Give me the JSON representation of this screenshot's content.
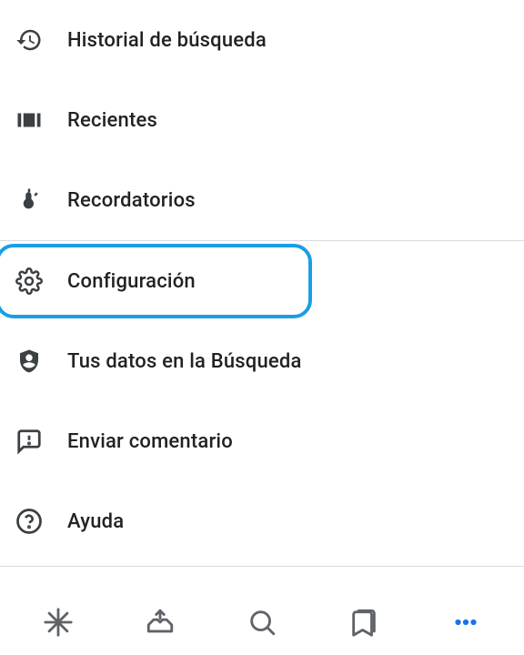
{
  "menu": {
    "items": [
      {
        "label": "Historial de búsqueda"
      },
      {
        "label": "Recientes"
      },
      {
        "label": "Recordatorios"
      },
      {
        "label": "Configuración"
      },
      {
        "label": "Tus datos en la Búsqueda"
      },
      {
        "label": "Enviar comentario"
      },
      {
        "label": "Ayuda"
      }
    ]
  },
  "colors": {
    "selectionBorder": "#1a9ee5",
    "icon": "#3c4043",
    "accent": "#1a73e8"
  }
}
